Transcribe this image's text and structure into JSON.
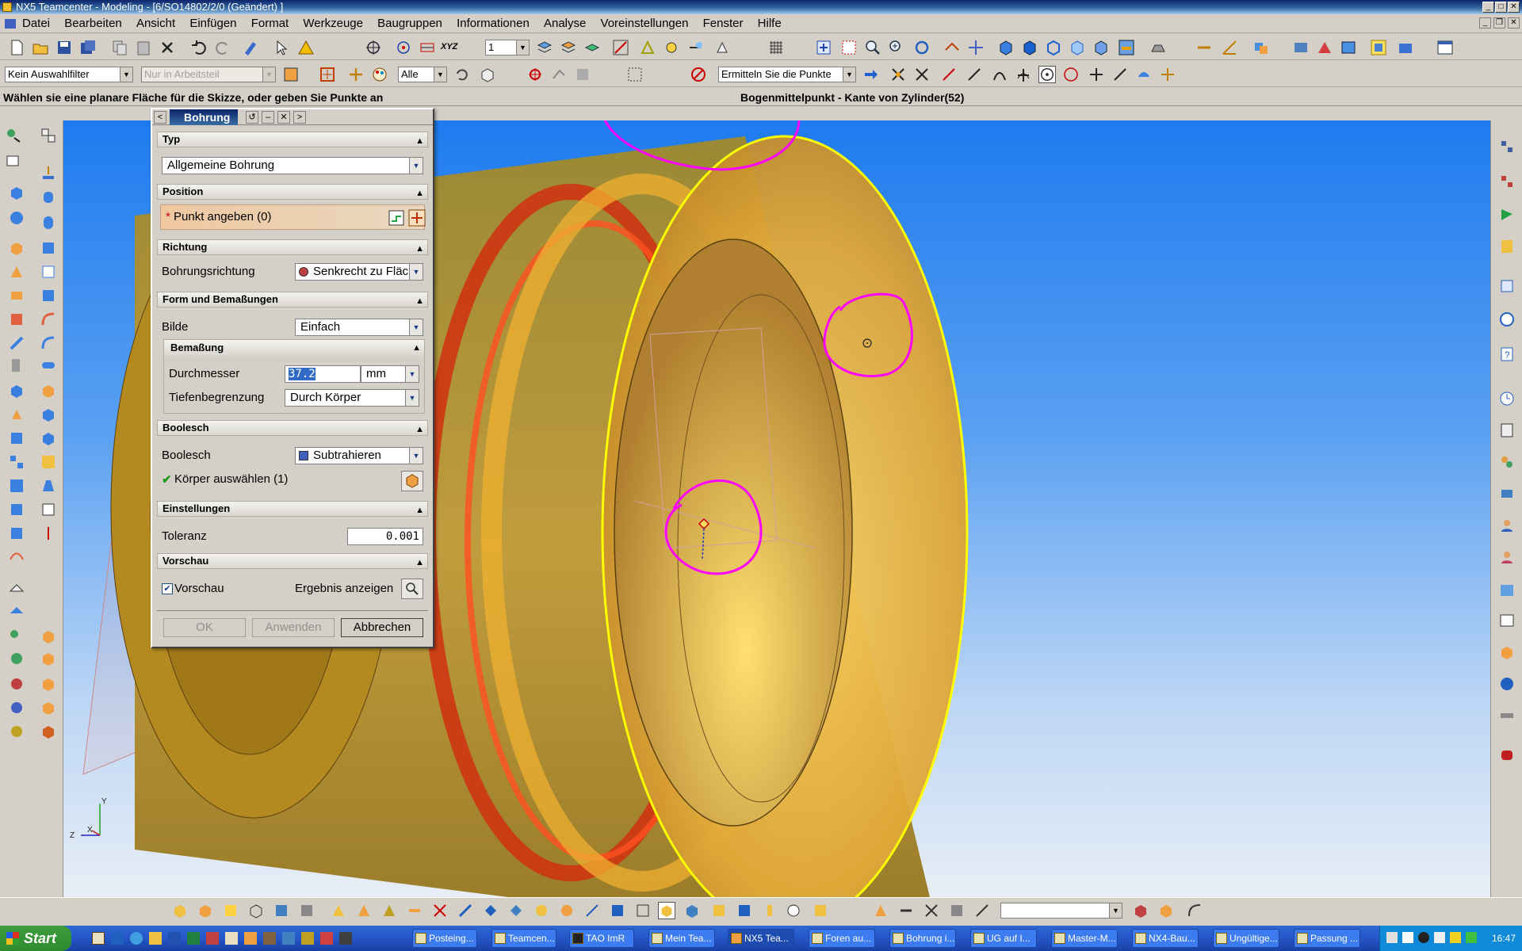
{
  "window": {
    "title": "NX5 Teamcenter - Modeling - [6/SO14802/2/0 (Geändert) ]"
  },
  "menu": {
    "items": [
      "Datei",
      "Bearbeiten",
      "Ansicht",
      "Einfügen",
      "Format",
      "Werkzeuge",
      "Baugruppen",
      "Informationen",
      "Analyse",
      "Voreinstellungen",
      "Fenster",
      "Hilfe"
    ]
  },
  "toolbar": {
    "layer_value": "1",
    "selection_filter": "Kein Auswahlfilter",
    "scope": "Nur in Arbeitsteil",
    "all_value": "Alle",
    "snap_combo": "Ermitteln Sie die Punkte",
    "xyz_label": "XYZ"
  },
  "status": {
    "prompt": "Wählen sie eine planare Fläche für die Skizze, oder geben Sie Punkte an",
    "selection_info": "Bogenmittelpunkt - Kante von Zylinder(52)"
  },
  "dialog": {
    "title": "Bohrung",
    "sections": {
      "typ": "Typ",
      "position": "Position",
      "richtung": "Richtung",
      "form": "Form und Bemaßungen",
      "bemassung": "Bemaßung",
      "boolesch": "Boolesch",
      "einstellungen": "Einstellungen",
      "vorschau": "Vorschau"
    },
    "typ_value": "Allgemeine Bohrung",
    "punkt_label": "Punkt angeben (0)",
    "bohrungsrichtung_label": "Bohrungsrichtung",
    "bohrungsrichtung_value": "Senkrecht zu Fläc",
    "bilde_label": "Bilde",
    "bilde_value": "Einfach",
    "durchmesser_label": "Durchmesser",
    "durchmesser_value": "37.2",
    "durchmesser_unit": "mm",
    "tiefen_label": "Tiefenbegrenzung",
    "tiefen_value": "Durch Körper",
    "boolesch_label": "Boolesch",
    "boolesch_value": "Subtrahieren",
    "koerper_label": "Körper auswählen (1)",
    "toleranz_label": "Toleranz",
    "toleranz_value": "0.001",
    "vorschau_label": "Vorschau",
    "ergebnis_label": "Ergebnis anzeigen",
    "ok_label": "OK",
    "anwenden_label": "Anwenden",
    "abbrechen_label": "Abbrechen"
  },
  "viewport": {
    "triad": {
      "z": "Z",
      "y": "Y",
      "x": "X"
    }
  },
  "taskbar": {
    "start": "Start",
    "tasks": [
      "Posteing...",
      "Teamcen...",
      "TAO ImR",
      "Mein Tea...",
      "NX5 Tea...",
      "Foren au...",
      "Bohrung i...",
      "UG auf I...",
      "Master-M...",
      "NX4-Bau...",
      "Ungültige...",
      "Passung ..."
    ],
    "active_index": 4,
    "clock": "16:47"
  },
  "colors": {
    "part": "#e8b030",
    "highlight": "#ffff00",
    "annotation": "#ff00ff",
    "viewport_top": "#1e7bef"
  }
}
